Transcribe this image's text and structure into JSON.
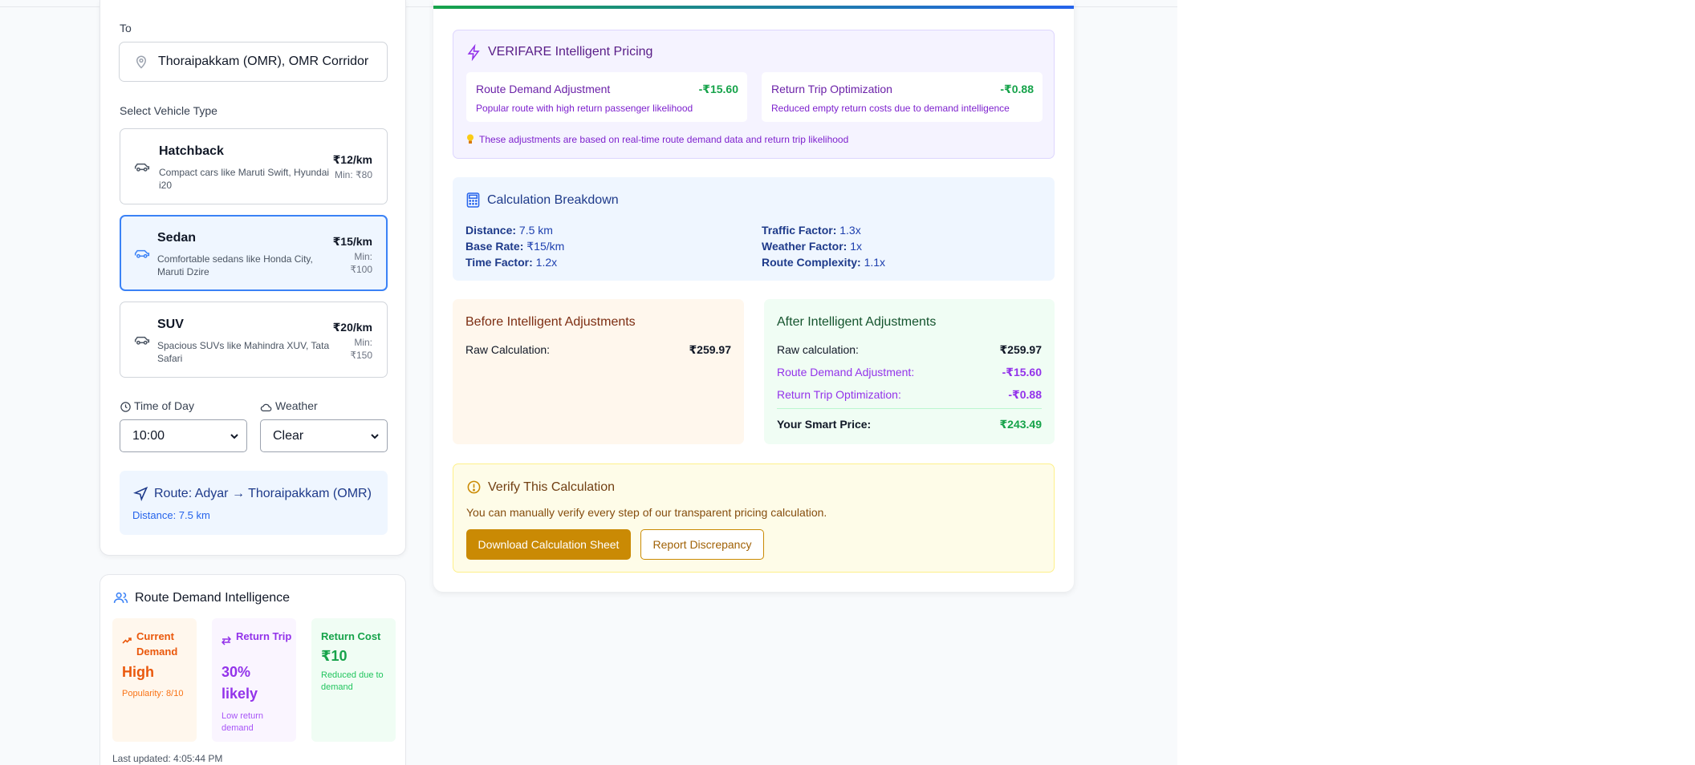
{
  "form": {
    "to_label": "To",
    "to_value": "Thoraipakkam (OMR), OMR Corridor",
    "vehicle_label": "Select Vehicle Type",
    "vehicles": [
      {
        "name": "Hatchback",
        "desc": "Compact cars like Maruti Swift, Hyundai i20",
        "price": "₹12/km",
        "min": "Min: ₹80"
      },
      {
        "name": "Sedan",
        "desc": "Comfortable sedans like Honda City, Maruti Dzire",
        "price": "₹15/km",
        "min": "Min: ₹100"
      },
      {
        "name": "SUV",
        "desc": "Spacious SUVs like Mahindra XUV, Tata Safari",
        "price": "₹20/km",
        "min": "Min: ₹150"
      }
    ],
    "selected_vehicle": "Sedan",
    "time_label": "Time of Day",
    "time_value": "10:00",
    "weather_label": "Weather",
    "weather_value": "Clear",
    "route_title": "Route: Adyar → Thoraipakkam (OMR)",
    "route_distance": "Distance: 7.5 km"
  },
  "demand": {
    "title": "Route Demand Intelligence",
    "tiles": [
      {
        "head": "Current Demand",
        "value": "High",
        "sub": "Popularity: 8/10"
      },
      {
        "head": "Return Trip",
        "value": "30% likely",
        "sub": "Low return demand"
      },
      {
        "head": "Return Cost",
        "value": "₹10",
        "sub": "Reduced due to demand"
      }
    ],
    "updated": "Last updated: 4:05:44 PM"
  },
  "verifare": {
    "title": "VERIFARE Intelligent Pricing",
    "boxes": [
      {
        "title": "Route Demand Adjustment",
        "value": "-₹15.60",
        "desc": "Popular route with high return passenger likelihood"
      },
      {
        "title": "Return Trip Optimization",
        "value": "-₹0.88",
        "desc": "Reduced empty return costs due to demand intelligence"
      }
    ],
    "note": "These adjustments are based on real-time route demand data and return trip likelihood"
  },
  "breakdown": {
    "title": "Calculation Breakdown",
    "items": [
      {
        "k": "Distance:",
        "v": "7.5 km"
      },
      {
        "k": "Base Rate:",
        "v": "₹15/km"
      },
      {
        "k": "Time Factor:",
        "v": "1.2x"
      },
      {
        "k": "Traffic Factor:",
        "v": "1.3x"
      },
      {
        "k": "Weather Factor:",
        "v": "1x"
      },
      {
        "k": "Route Complexity:",
        "v": "1.1x"
      }
    ]
  },
  "before": {
    "title": "Before Intelligent Adjustments",
    "raw_label": "Raw Calculation:",
    "raw_value": "₹259.97"
  },
  "after": {
    "title": "After Intelligent Adjustments",
    "raw_label": "Raw calculation:",
    "raw_value": "₹259.97",
    "route_label": "Route Demand Adjustment:",
    "route_value": "-₹15.60",
    "return_label": "Return Trip Optimization:",
    "return_value": "-₹0.88",
    "smart_label": "Your Smart Price:",
    "smart_value": "₹243.49"
  },
  "verify": {
    "title": "Verify This Calculation",
    "desc": "You can manually verify every step of our transparent pricing calculation.",
    "download_label": "Download Calculation Sheet",
    "report_label": "Report Discrepancy"
  },
  "colors": {
    "accent_blue": "#3b82f6",
    "purple": "#7e22ce",
    "green": "#16a34a",
    "amber": "#ca8a04"
  }
}
